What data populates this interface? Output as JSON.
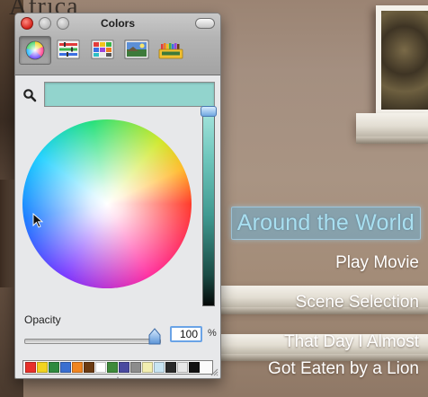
{
  "background": {
    "partial_title": "Africa",
    "menu": {
      "selected_title": "Around the World",
      "items": [
        "Play Movie",
        "Scene Selection",
        "That Day I Almost",
        "Got Eaten by a Lion"
      ]
    }
  },
  "colors_panel": {
    "window_title": "Colors",
    "modes": [
      {
        "name": "color-wheel",
        "icon": "color-wheel-icon",
        "active": true
      },
      {
        "name": "color-sliders",
        "icon": "sliders-icon",
        "active": false
      },
      {
        "name": "color-palettes",
        "icon": "palette-grid-icon",
        "active": false
      },
      {
        "name": "image-palettes",
        "icon": "image-palette-icon",
        "active": false
      },
      {
        "name": "crayons",
        "icon": "crayon-box-icon",
        "active": false
      }
    ],
    "current_color": "#92d4cd",
    "brightness_level": 1.0,
    "opacity": {
      "label": "Opacity",
      "value": "100",
      "unit": "%"
    },
    "swatches": [
      "#e8302a",
      "#f2d41f",
      "#2f8a3e",
      "#3a6fd0",
      "#f08520",
      "#6b3b12",
      "#ffffff",
      "#3e8a3a",
      "#4a4aa0",
      "#8c8c8c",
      "#f3efb0",
      "#c8e4f2",
      "#2a2a2a",
      "#e8e8e8",
      "#111111"
    ]
  }
}
